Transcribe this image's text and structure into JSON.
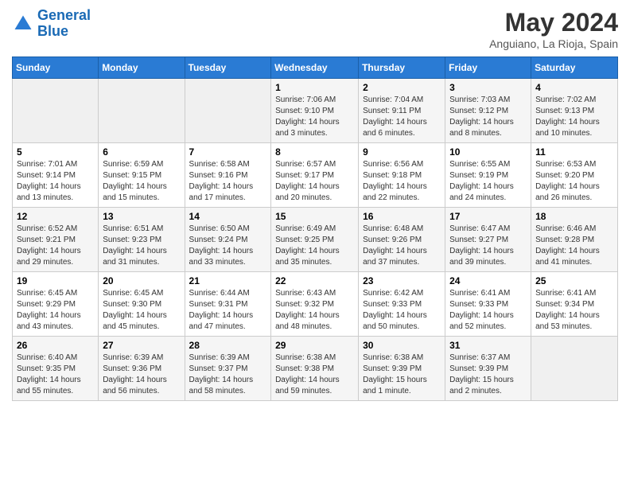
{
  "header": {
    "logo_line1": "General",
    "logo_line2": "Blue",
    "month_title": "May 2024",
    "location": "Anguiano, La Rioja, Spain"
  },
  "weekdays": [
    "Sunday",
    "Monday",
    "Tuesday",
    "Wednesday",
    "Thursday",
    "Friday",
    "Saturday"
  ],
  "weeks": [
    [
      {
        "day": "",
        "sunrise": "",
        "sunset": "",
        "daylight": ""
      },
      {
        "day": "",
        "sunrise": "",
        "sunset": "",
        "daylight": ""
      },
      {
        "day": "",
        "sunrise": "",
        "sunset": "",
        "daylight": ""
      },
      {
        "day": "1",
        "sunrise": "Sunrise: 7:06 AM",
        "sunset": "Sunset: 9:10 PM",
        "daylight": "Daylight: 14 hours and 3 minutes."
      },
      {
        "day": "2",
        "sunrise": "Sunrise: 7:04 AM",
        "sunset": "Sunset: 9:11 PM",
        "daylight": "Daylight: 14 hours and 6 minutes."
      },
      {
        "day": "3",
        "sunrise": "Sunrise: 7:03 AM",
        "sunset": "Sunset: 9:12 PM",
        "daylight": "Daylight: 14 hours and 8 minutes."
      },
      {
        "day": "4",
        "sunrise": "Sunrise: 7:02 AM",
        "sunset": "Sunset: 9:13 PM",
        "daylight": "Daylight: 14 hours and 10 minutes."
      }
    ],
    [
      {
        "day": "5",
        "sunrise": "Sunrise: 7:01 AM",
        "sunset": "Sunset: 9:14 PM",
        "daylight": "Daylight: 14 hours and 13 minutes."
      },
      {
        "day": "6",
        "sunrise": "Sunrise: 6:59 AM",
        "sunset": "Sunset: 9:15 PM",
        "daylight": "Daylight: 14 hours and 15 minutes."
      },
      {
        "day": "7",
        "sunrise": "Sunrise: 6:58 AM",
        "sunset": "Sunset: 9:16 PM",
        "daylight": "Daylight: 14 hours and 17 minutes."
      },
      {
        "day": "8",
        "sunrise": "Sunrise: 6:57 AM",
        "sunset": "Sunset: 9:17 PM",
        "daylight": "Daylight: 14 hours and 20 minutes."
      },
      {
        "day": "9",
        "sunrise": "Sunrise: 6:56 AM",
        "sunset": "Sunset: 9:18 PM",
        "daylight": "Daylight: 14 hours and 22 minutes."
      },
      {
        "day": "10",
        "sunrise": "Sunrise: 6:55 AM",
        "sunset": "Sunset: 9:19 PM",
        "daylight": "Daylight: 14 hours and 24 minutes."
      },
      {
        "day": "11",
        "sunrise": "Sunrise: 6:53 AM",
        "sunset": "Sunset: 9:20 PM",
        "daylight": "Daylight: 14 hours and 26 minutes."
      }
    ],
    [
      {
        "day": "12",
        "sunrise": "Sunrise: 6:52 AM",
        "sunset": "Sunset: 9:21 PM",
        "daylight": "Daylight: 14 hours and 29 minutes."
      },
      {
        "day": "13",
        "sunrise": "Sunrise: 6:51 AM",
        "sunset": "Sunset: 9:23 PM",
        "daylight": "Daylight: 14 hours and 31 minutes."
      },
      {
        "day": "14",
        "sunrise": "Sunrise: 6:50 AM",
        "sunset": "Sunset: 9:24 PM",
        "daylight": "Daylight: 14 hours and 33 minutes."
      },
      {
        "day": "15",
        "sunrise": "Sunrise: 6:49 AM",
        "sunset": "Sunset: 9:25 PM",
        "daylight": "Daylight: 14 hours and 35 minutes."
      },
      {
        "day": "16",
        "sunrise": "Sunrise: 6:48 AM",
        "sunset": "Sunset: 9:26 PM",
        "daylight": "Daylight: 14 hours and 37 minutes."
      },
      {
        "day": "17",
        "sunrise": "Sunrise: 6:47 AM",
        "sunset": "Sunset: 9:27 PM",
        "daylight": "Daylight: 14 hours and 39 minutes."
      },
      {
        "day": "18",
        "sunrise": "Sunrise: 6:46 AM",
        "sunset": "Sunset: 9:28 PM",
        "daylight": "Daylight: 14 hours and 41 minutes."
      }
    ],
    [
      {
        "day": "19",
        "sunrise": "Sunrise: 6:45 AM",
        "sunset": "Sunset: 9:29 PM",
        "daylight": "Daylight: 14 hours and 43 minutes."
      },
      {
        "day": "20",
        "sunrise": "Sunrise: 6:45 AM",
        "sunset": "Sunset: 9:30 PM",
        "daylight": "Daylight: 14 hours and 45 minutes."
      },
      {
        "day": "21",
        "sunrise": "Sunrise: 6:44 AM",
        "sunset": "Sunset: 9:31 PM",
        "daylight": "Daylight: 14 hours and 47 minutes."
      },
      {
        "day": "22",
        "sunrise": "Sunrise: 6:43 AM",
        "sunset": "Sunset: 9:32 PM",
        "daylight": "Daylight: 14 hours and 48 minutes."
      },
      {
        "day": "23",
        "sunrise": "Sunrise: 6:42 AM",
        "sunset": "Sunset: 9:33 PM",
        "daylight": "Daylight: 14 hours and 50 minutes."
      },
      {
        "day": "24",
        "sunrise": "Sunrise: 6:41 AM",
        "sunset": "Sunset: 9:33 PM",
        "daylight": "Daylight: 14 hours and 52 minutes."
      },
      {
        "day": "25",
        "sunrise": "Sunrise: 6:41 AM",
        "sunset": "Sunset: 9:34 PM",
        "daylight": "Daylight: 14 hours and 53 minutes."
      }
    ],
    [
      {
        "day": "26",
        "sunrise": "Sunrise: 6:40 AM",
        "sunset": "Sunset: 9:35 PM",
        "daylight": "Daylight: 14 hours and 55 minutes."
      },
      {
        "day": "27",
        "sunrise": "Sunrise: 6:39 AM",
        "sunset": "Sunset: 9:36 PM",
        "daylight": "Daylight: 14 hours and 56 minutes."
      },
      {
        "day": "28",
        "sunrise": "Sunrise: 6:39 AM",
        "sunset": "Sunset: 9:37 PM",
        "daylight": "Daylight: 14 hours and 58 minutes."
      },
      {
        "day": "29",
        "sunrise": "Sunrise: 6:38 AM",
        "sunset": "Sunset: 9:38 PM",
        "daylight": "Daylight: 14 hours and 59 minutes."
      },
      {
        "day": "30",
        "sunrise": "Sunrise: 6:38 AM",
        "sunset": "Sunset: 9:39 PM",
        "daylight": "Daylight: 15 hours and 1 minute."
      },
      {
        "day": "31",
        "sunrise": "Sunrise: 6:37 AM",
        "sunset": "Sunset: 9:39 PM",
        "daylight": "Daylight: 15 hours and 2 minutes."
      },
      {
        "day": "",
        "sunrise": "",
        "sunset": "",
        "daylight": ""
      }
    ]
  ]
}
